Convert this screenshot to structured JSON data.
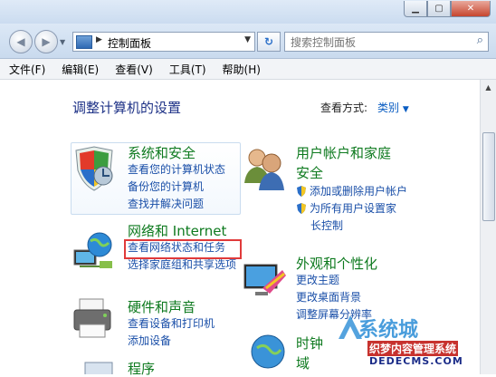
{
  "address": {
    "label": "控制面板"
  },
  "search": {
    "placeholder": "搜索控制面板"
  },
  "menus": [
    "文件(F)",
    "编辑(E)",
    "查看(V)",
    "工具(T)",
    "帮助(H)"
  ],
  "page": {
    "heading": "调整计算机的设置",
    "view_by_label": "查看方式:",
    "view_by_value": "类别"
  },
  "categories": {
    "security": {
      "title": "系统和安全",
      "links": [
        "查看您的计算机状态",
        "备份您的计算机",
        "查找并解决问题"
      ]
    },
    "network": {
      "title": "网络和 Internet",
      "links": [
        "查看网络状态和任务",
        "选择家庭组和共享选项"
      ]
    },
    "hardware": {
      "title": "硬件和声音",
      "links": [
        "查看设备和打印机",
        "添加设备"
      ]
    },
    "programs": {
      "title": "程序"
    },
    "users": {
      "title_line1": "用户帐户和家庭",
      "title_line2": "安全",
      "links": [
        "添加或删除用户帐户",
        "为所有用户设置家",
        "长控制"
      ]
    },
    "appearance": {
      "title": "外观和个性化",
      "links": [
        "更改主题",
        "更改桌面背景",
        "调整屏幕分辨率"
      ]
    },
    "clock": {
      "title_line1": "时钟",
      "title_line2": "域"
    }
  },
  "watermark": {
    "brand": "系统城",
    "sub": "织梦内容管理系统",
    "url": "DEDECMS.COM"
  }
}
